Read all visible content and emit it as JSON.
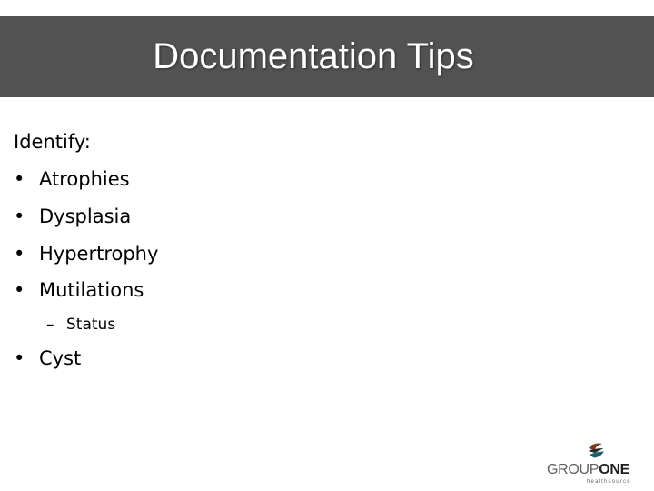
{
  "slide": {
    "title": "Documentation Tips",
    "intro": "Identify:",
    "bullets": [
      {
        "marker": "•",
        "text": "Atrophies"
      },
      {
        "marker": "•",
        "text": "Dysplasia"
      },
      {
        "marker": "•",
        "text": "Hypertrophy"
      },
      {
        "marker": "•",
        "text": "Mutilations"
      }
    ],
    "sub_bullet": {
      "marker": "–",
      "text": "Status"
    },
    "last_bullet": {
      "marker": "•",
      "text": "Cyst"
    }
  },
  "logo": {
    "icon": "swirl-globe-icon",
    "word_part1": "GROUP",
    "word_part2": "ONE",
    "tagline": "healthsource"
  },
  "colors": {
    "title_bar": "#525252",
    "title_text": "#ffffff",
    "logo_brown": "#7a3b22",
    "logo_teal": "#1f5f6b"
  }
}
